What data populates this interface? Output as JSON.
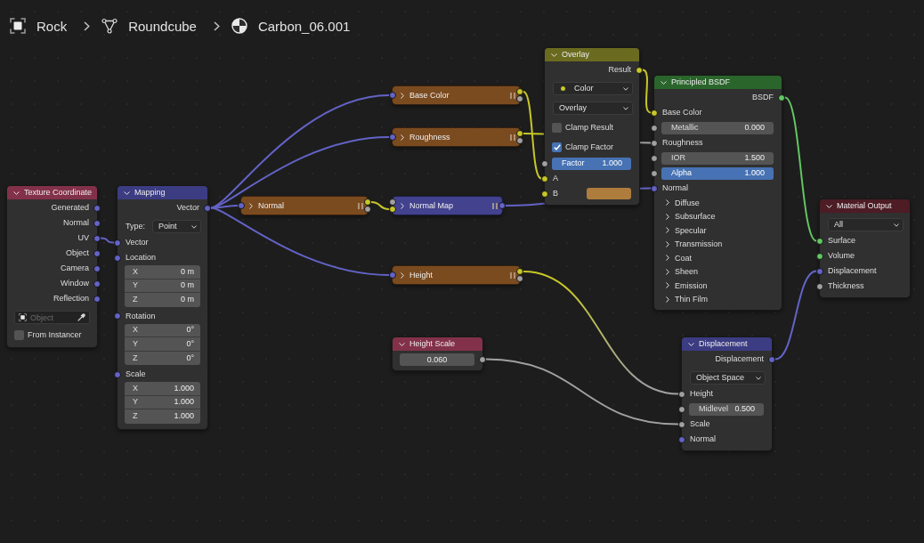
{
  "breadcrumb": [
    {
      "kind": "object",
      "label": "Rock"
    },
    {
      "kind": "mesh",
      "label": "Roundcube"
    },
    {
      "kind": "material",
      "label": "Carbon_06.001"
    }
  ],
  "nodes": [
    {
      "kind": "texture",
      "title": "Texture Coordinate",
      "collapsed": false,
      "rows": [
        {
          "kind": "output",
          "label": "Generated",
          "socket": {
            "kind": "vector"
          }
        },
        {
          "kind": "output",
          "label": "Normal",
          "socket": {
            "kind": "vector"
          }
        },
        {
          "kind": "output",
          "label": "UV",
          "socket": {
            "kind": "vector"
          }
        },
        {
          "kind": "output",
          "label": "Object",
          "socket": {
            "kind": "vector"
          }
        },
        {
          "kind": "output",
          "label": "Camera",
          "socket": {
            "kind": "vector"
          }
        },
        {
          "kind": "output",
          "label": "Window",
          "socket": {
            "kind": "vector"
          }
        },
        {
          "kind": "output",
          "label": "Reflection",
          "socket": {
            "kind": "vector"
          }
        },
        {
          "kind": "object",
          "placeholder": "Object"
        },
        {
          "kind": "checkbox",
          "label": "From Instancer",
          "checked": false
        }
      ]
    },
    {
      "kind": "vector",
      "title": "Mapping",
      "collapsed": false,
      "rows": [
        {
          "kind": "output",
          "label": "Vector",
          "socket": {
            "kind": "vector"
          }
        },
        {
          "kind": "dropdown",
          "label": "Type:",
          "value": "Point"
        },
        {
          "kind": "input",
          "label": "Vector",
          "socket": {
            "kind": "vector"
          }
        },
        {
          "kind": "vector",
          "label": "Location",
          "socket": {
            "kind": "vector"
          },
          "fields": [
            {
              "label": "X",
              "value": "0 m"
            },
            {
              "label": "Y",
              "value": "0 m"
            },
            {
              "label": "Z",
              "value": "0 m"
            }
          ]
        },
        {
          "kind": "vector",
          "label": "Rotation",
          "socket": {
            "kind": "vector"
          },
          "fields": [
            {
              "label": "X",
              "value": "0°"
            },
            {
              "label": "Y",
              "value": "0°"
            },
            {
              "label": "Z",
              "value": "0°"
            }
          ]
        },
        {
          "kind": "vector",
          "label": "Scale",
          "socket": {
            "kind": "vector"
          },
          "fields": [
            {
              "label": "X",
              "value": "1.000"
            },
            {
              "label": "Y",
              "value": "1.000"
            },
            {
              "label": "Z",
              "value": "1.000"
            }
          ]
        }
      ]
    },
    {
      "kind": "group",
      "title": "Normal",
      "collapsed": true,
      "inputs": [
        {
          "kind": "vector"
        }
      ],
      "outputs": [
        {
          "kind": "color"
        },
        {
          "kind": "float"
        }
      ]
    },
    {
      "kind": "group",
      "title": "Base Color",
      "collapsed": true,
      "inputs": [
        {
          "kind": "vector"
        }
      ],
      "outputs": [
        {
          "kind": "color"
        },
        {
          "kind": "float"
        }
      ]
    },
    {
      "kind": "group",
      "title": "Roughness",
      "collapsed": true,
      "inputs": [
        {
          "kind": "vector"
        }
      ],
      "outputs": [
        {
          "kind": "color"
        },
        {
          "kind": "float"
        }
      ]
    },
    {
      "kind": "vector",
      "title": "Normal Map",
      "collapsed": true,
      "inputs": [
        {
          "kind": "float"
        },
        {
          "kind": "color"
        }
      ],
      "outputs": [
        {
          "kind": "vector"
        }
      ]
    },
    {
      "kind": "group",
      "title": "Height",
      "collapsed": true,
      "inputs": [
        {
          "kind": "vector"
        }
      ],
      "outputs": [
        {
          "kind": "color"
        },
        {
          "kind": "float"
        }
      ]
    },
    {
      "kind": "input",
      "title": "Height Scale",
      "collapsed": false,
      "rows": [
        {
          "kind": "value",
          "value": "0.060",
          "socket": {
            "kind": "float"
          }
        }
      ]
    },
    {
      "kind": "color",
      "title": "Overlay",
      "collapsed": false,
      "rows": [
        {
          "kind": "output",
          "label": "Result",
          "socket": {
            "kind": "color"
          }
        },
        {
          "kind": "dropdown",
          "value": "Color",
          "dot": {
            "kind": "color"
          }
        },
        {
          "kind": "dropdown",
          "value": "Overlay"
        },
        {
          "kind": "checkbox",
          "label": "Clamp Result",
          "checked": false
        },
        {
          "kind": "checkbox",
          "label": "Clamp Factor",
          "checked": true
        },
        {
          "kind": "slider",
          "label": "Factor",
          "value": "1.000",
          "level": 1,
          "socket": {
            "kind": "float"
          }
        },
        {
          "kind": "input",
          "label": "A",
          "socket": {
            "kind": "color"
          }
        },
        {
          "kind": "swatch",
          "label": "B",
          "socket": {
            "kind": "color"
          },
          "color": "#ae7d3d"
        }
      ]
    },
    {
      "kind": "shader",
      "title": "Principled BSDF",
      "collapsed": false,
      "rows": [
        {
          "kind": "output",
          "label": "BSDF",
          "socket": {
            "kind": "shader"
          }
        },
        {
          "kind": "input",
          "label": "Base Color",
          "socket": {
            "kind": "color"
          }
        },
        {
          "kind": "number",
          "label": "Metallic",
          "value": "0.000",
          "socket": {
            "kind": "float"
          }
        },
        {
          "kind": "input",
          "label": "Roughness",
          "socket": {
            "kind": "float"
          }
        },
        {
          "kind": "number",
          "label": "IOR",
          "value": "1.500",
          "socket": {
            "kind": "float"
          }
        },
        {
          "kind": "slider",
          "label": "Alpha",
          "value": "1.000",
          "level": 1,
          "socket": {
            "kind": "float"
          }
        },
        {
          "kind": "input",
          "label": "Normal",
          "socket": {
            "kind": "vector"
          }
        },
        {
          "kind": "panel",
          "label": "Diffuse",
          "expanded": false
        },
        {
          "kind": "panel",
          "label": "Subsurface",
          "expanded": false
        },
        {
          "kind": "panel",
          "label": "Specular",
          "expanded": false
        },
        {
          "kind": "panel",
          "label": "Transmission",
          "expanded": false
        },
        {
          "kind": "panel",
          "label": "Coat",
          "expanded": false
        },
        {
          "kind": "panel",
          "label": "Sheen",
          "expanded": false
        },
        {
          "kind": "panel",
          "label": "Emission",
          "expanded": false
        },
        {
          "kind": "panel",
          "label": "Thin Film",
          "expanded": false
        }
      ]
    },
    {
      "kind": "output",
      "title": "Material Output",
      "collapsed": false,
      "rows": [
        {
          "kind": "dropdown",
          "value": "All"
        },
        {
          "kind": "input",
          "label": "Surface",
          "socket": {
            "kind": "shader"
          }
        },
        {
          "kind": "input",
          "label": "Volume",
          "socket": {
            "kind": "shader"
          }
        },
        {
          "kind": "input",
          "label": "Displacement",
          "socket": {
            "kind": "vector"
          }
        },
        {
          "kind": "input",
          "label": "Thickness",
          "socket": {
            "kind": "float"
          }
        }
      ]
    },
    {
      "kind": "vector",
      "title": "Displacement",
      "collapsed": false,
      "rows": [
        {
          "kind": "output",
          "label": "Displacement",
          "socket": {
            "kind": "vector"
          }
        },
        {
          "kind": "dropdown",
          "value": "Object Space"
        },
        {
          "kind": "input",
          "label": "Height",
          "socket": {
            "kind": "float"
          }
        },
        {
          "kind": "number",
          "label": "Midlevel",
          "value": "0.500",
          "socket": {
            "kind": "float"
          }
        },
        {
          "kind": "input",
          "label": "Scale",
          "socket": {
            "kind": "float"
          }
        },
        {
          "kind": "input",
          "label": "Normal",
          "socket": {
            "kind": "vector"
          }
        }
      ]
    }
  ]
}
